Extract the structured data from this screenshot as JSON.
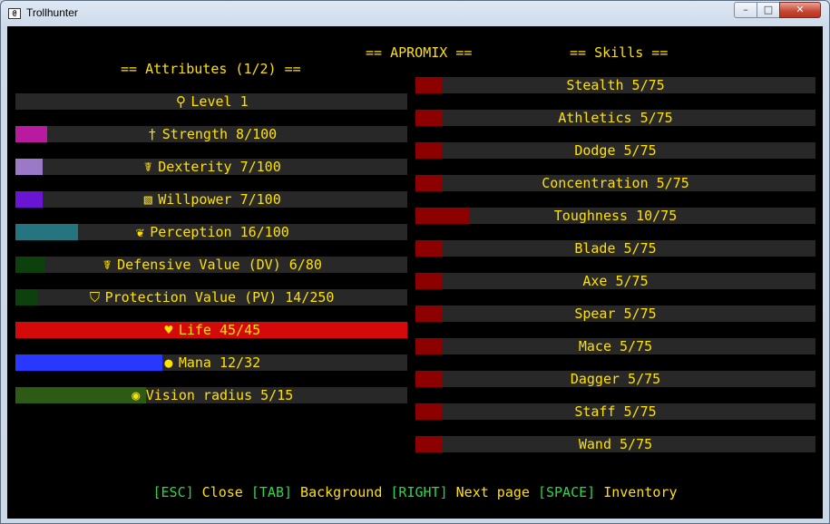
{
  "window": {
    "title": "Trollhunter",
    "icon_text": "@",
    "minimize_icon": "–",
    "maximize_icon": "□",
    "close_icon": "✕"
  },
  "header": {
    "center": "== APROMIX ==",
    "left": "== Attributes (1/2) ==",
    "right": "== Skills =="
  },
  "attributes": [
    {
      "label": "Level 1",
      "icon": "flask-icon",
      "glyph": "⚲",
      "fill": 0,
      "color": "#282828"
    },
    {
      "label": "Strength 8/100",
      "icon": "strength-icon",
      "glyph": "†",
      "fill": 0.08,
      "color": "#b81aa0"
    },
    {
      "label": "Dexterity 7/100",
      "icon": "running-icon",
      "glyph": "☤",
      "fill": 0.07,
      "color": "#9b79c8"
    },
    {
      "label": "Willpower 7/100",
      "icon": "book-icon",
      "glyph": "▧",
      "fill": 0.07,
      "color": "#6a14d4"
    },
    {
      "label": "Perception 16/100",
      "icon": "leaf-icon",
      "glyph": "❦",
      "fill": 0.16,
      "color": "#247580"
    },
    {
      "label": "Defensive Value (DV) 6/80",
      "icon": "dodge-icon",
      "glyph": "☤",
      "fill": 0.075,
      "color": "#0c400c"
    },
    {
      "label": "Protection Value (PV) 14/250",
      "icon": "shield-icon",
      "glyph": "⛉",
      "fill": 0.056,
      "color": "#0c400c"
    },
    {
      "label": "Life 45/45",
      "icon": "heart-icon",
      "glyph": "♥",
      "fill": 1.0,
      "color": "#d40a0a"
    },
    {
      "label": "Mana 12/32",
      "icon": "mana-orb-icon",
      "glyph": "●",
      "fill": 0.375,
      "color": "#2838ff"
    },
    {
      "label": "Vision radius 5/15",
      "icon": "eye-icon",
      "glyph": "◉",
      "fill": 0.333,
      "color": "#2d5a15"
    }
  ],
  "skills": [
    {
      "label": "Stealth 5/75",
      "fill": 0.0667
    },
    {
      "label": "Athletics 5/75",
      "fill": 0.0667
    },
    {
      "label": "Dodge 5/75",
      "fill": 0.0667
    },
    {
      "label": "Concentration 5/75",
      "fill": 0.0667
    },
    {
      "label": "Toughness 10/75",
      "fill": 0.1333
    },
    {
      "label": "Blade 5/75",
      "fill": 0.0667
    },
    {
      "label": "Axe 5/75",
      "fill": 0.0667
    },
    {
      "label": "Spear 5/75",
      "fill": 0.0667
    },
    {
      "label": "Mace 5/75",
      "fill": 0.0667
    },
    {
      "label": "Dagger 5/75",
      "fill": 0.0667
    },
    {
      "label": "Staff 5/75",
      "fill": 0.0667
    },
    {
      "label": "Wand 5/75",
      "fill": 0.0667
    }
  ],
  "skill_color": "#8c0000",
  "bar_track_color": "#282828",
  "text_color": "#ffe100",
  "key_color": "#2ed74a",
  "footer": [
    {
      "key": "[ESC]",
      "action": "Close"
    },
    {
      "key": "[TAB]",
      "action": "Background"
    },
    {
      "key": "[RIGHT]",
      "action": "Next page"
    },
    {
      "key": "[SPACE]",
      "action": "Inventory"
    }
  ]
}
